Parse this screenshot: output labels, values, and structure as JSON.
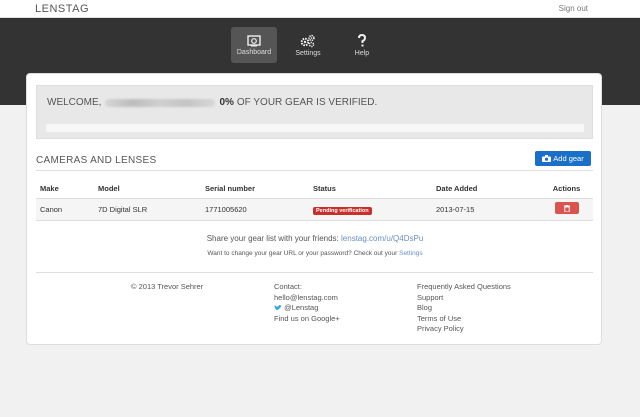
{
  "header": {
    "brand": "LENSTAG",
    "signout": "Sign out"
  },
  "nav": [
    {
      "label": "Dashboard",
      "icon": "dashboard-icon",
      "active": true
    },
    {
      "label": "Settings",
      "icon": "gears-icon",
      "active": false
    },
    {
      "label": "Help",
      "icon": "question-icon",
      "active": false
    }
  ],
  "welcome": {
    "prefix": "WELCOME,",
    "percent": "0%",
    "suffix": "OF YOUR GEAR IS VERIFIED.",
    "progress": 0
  },
  "gear": {
    "title": "CAMERAS AND LENSES",
    "add_label": "Add gear",
    "columns": [
      "Make",
      "Model",
      "Serial number",
      "Status",
      "Date Added",
      "Actions"
    ],
    "rows": [
      {
        "make": "Canon",
        "model": "7D Digital SLR",
        "serial": "1771005620",
        "status": "Pending verification",
        "date": "2013-07-15"
      }
    ]
  },
  "share": {
    "text": "Share your gear list with your friends:",
    "url": "lenstag.com/u/Q4DsPu"
  },
  "change": {
    "text": "Want to change your gear URL or your password? Check out your",
    "link": "Settings"
  },
  "footer": {
    "copyright": "© 2013 Trevor Sehrer",
    "contact_heading": "Contact:",
    "email": "hello@lenstag.com",
    "twitter": "@Lenstag",
    "google": "Find us on Google+",
    "links": [
      "Frequently Asked Questions",
      "Support",
      "Blog",
      "Terms of Use",
      "Privacy Policy"
    ]
  },
  "colors": {
    "nav_bg": "#333333",
    "primary": "#1a70c8",
    "danger": "#d9534f",
    "pending": "#c9302c"
  }
}
